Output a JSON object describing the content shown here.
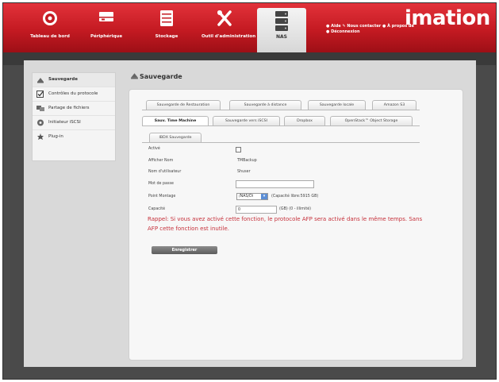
{
  "topnav": {
    "items": [
      {
        "label": "Tableau de bord",
        "icon": "dashboard-icon"
      },
      {
        "label": "Périphérique",
        "icon": "device-icon"
      },
      {
        "label": "Stockage",
        "icon": "storage-icon"
      },
      {
        "label": "Outil d'administration",
        "icon": "tools-icon"
      },
      {
        "label": "NAS",
        "icon": "nas-icon"
      }
    ],
    "links": {
      "help": "Aide",
      "contact": "Nous contacter",
      "about": "À propos de",
      "logout": "Déconnexion"
    },
    "brand": "imation"
  },
  "sidebar": {
    "items": [
      {
        "label": "Sauvegarde",
        "icon": "backup-icon"
      },
      {
        "label": "Contrôles du protocole",
        "icon": "checkbox-icon"
      },
      {
        "label": "Partage de fichiers",
        "icon": "share-icon"
      },
      {
        "label": "Initiateur iSCSI",
        "icon": "iscsi-icon"
      },
      {
        "label": "Plug-in",
        "icon": "plugin-icon"
      }
    ]
  },
  "main": {
    "title": "Sauvegarde",
    "tabs_row1": [
      "Sauvegarde de Restauration",
      "Sauvegarde à distance",
      "Sauvegarde locale",
      "Amazon S3"
    ],
    "tabs_row2": [
      "Sauv. Time Machine",
      "Sauvegarde vers iSCSI",
      "Dropbox",
      "OpenStack™ Object Storage"
    ],
    "tabs_row3": [
      "IBDX Sauvegarde"
    ],
    "form": {
      "enabled_label": "Activé",
      "display_name_label": "Afficher Nom",
      "display_name_value": "TMBackup",
      "username_label": "Nom d'utilisateur",
      "username_value": "Shuser",
      "password_label": "Mot de passe",
      "volume_label": "Point Montage",
      "volume_value": "/NAS/Di",
      "volume_capacity": "(Capacité libre:5915 GB)",
      "capacity_label": "Capacité",
      "capacity_value": "0",
      "capacity_hint": "(GB) (0 - illimité)"
    },
    "note": "Rappel: Si vous avez activé cette fonction, le protocole AFP sera activé dans le même temps. Sans AFP cette fonction est inutile.",
    "save_label": "Enregistrer"
  },
  "colors": {
    "brand_red": "#c41a22",
    "note_red": "#c6303a",
    "panel_gray": "#d9d9d9"
  }
}
